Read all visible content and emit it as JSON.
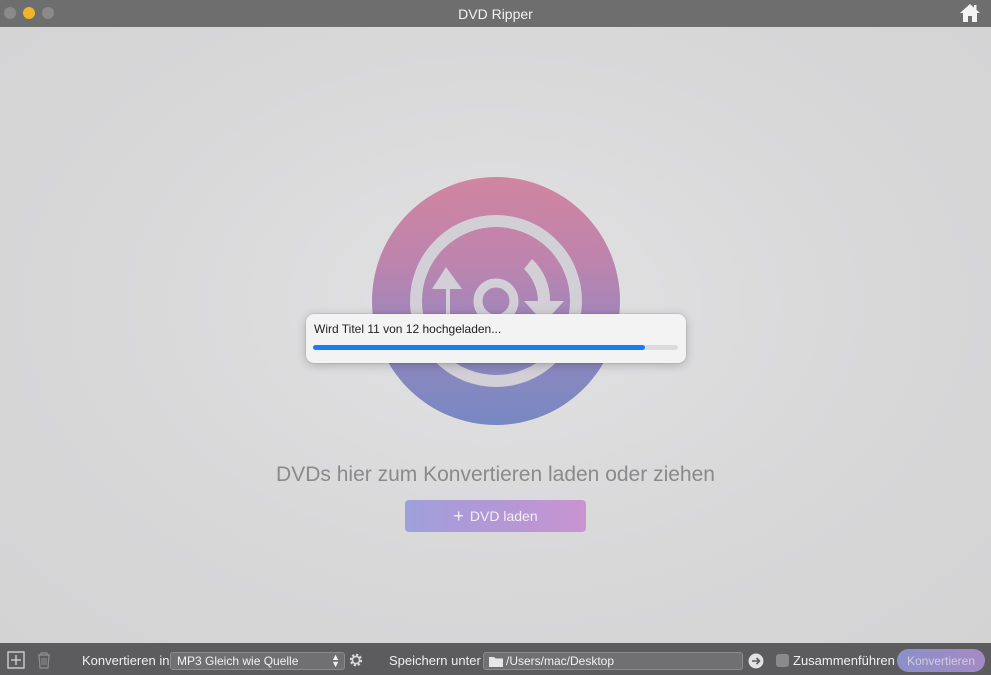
{
  "window": {
    "title": "DVD Ripper"
  },
  "main": {
    "drop_text": "DVDs hier zum Konvertieren laden oder ziehen",
    "load_button_label": "DVD laden"
  },
  "dialog": {
    "message": "Wird Titel 11 von 12 hochgeladen...",
    "progress": 0.91
  },
  "bottombar": {
    "convert_to_label": "Konvertieren in",
    "format_value": "MP3 Gleich wie Quelle",
    "save_label": "Speichern unter",
    "path_value": "/Users/mac/Desktop",
    "merge_label": "Zusammenführen",
    "convert_button_label": "Konvertieren"
  },
  "icons": {
    "home": "home-icon",
    "add": "plus-square-icon",
    "delete": "trash-icon",
    "settings": "gear-icon",
    "folder": "folder-icon",
    "open": "arrow-right-circle-icon"
  },
  "colors": {
    "progress": "#1a7cf2",
    "titlebar": "#6e6e6e",
    "bottombar": "#5c5c5e"
  }
}
